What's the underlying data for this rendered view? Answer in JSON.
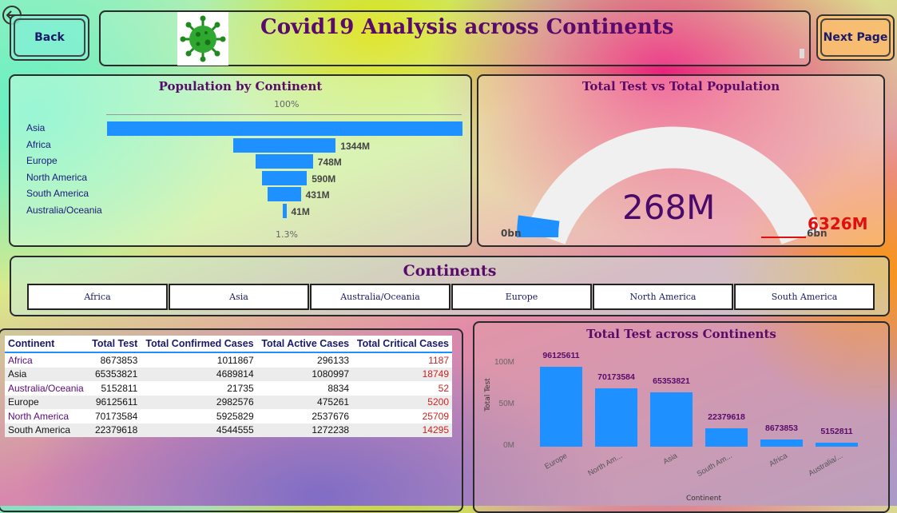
{
  "header": {
    "title": "Covid19 Analysis across Continents",
    "back_label": "Back",
    "next_label": "Next Page"
  },
  "population_chart": {
    "title": "Population by Continent",
    "top_label": "100%",
    "bottom_label": "1.3%",
    "rows": [
      {
        "label": "Asia",
        "value": 4650,
        "value_label": ""
      },
      {
        "label": "Africa",
        "value": 1344,
        "value_label": "1344M"
      },
      {
        "label": "Europe",
        "value": 748,
        "value_label": "748M"
      },
      {
        "label": "North America",
        "value": 590,
        "value_label": "590M"
      },
      {
        "label": "South America",
        "value": 431,
        "value_label": "431M"
      },
      {
        "label": "Australia/Oceania",
        "value": 41,
        "value_label": "41M"
      }
    ]
  },
  "gauge": {
    "title": "Total Test vs Total Population",
    "value_label": "268M",
    "min_label": "0bn",
    "max_label": "6bn",
    "target_label": "6326M",
    "fill_fraction": 0.045
  },
  "slicer": {
    "title": "Continents",
    "options": [
      "Africa",
      "Asia",
      "Australia/Oceania",
      "Europe",
      "North America",
      "South America"
    ]
  },
  "table": {
    "columns": [
      "Continent",
      "Total Test",
      "Total Confirmed Cases",
      "Total Active Cases",
      "Total Critical Cases"
    ],
    "rows": [
      [
        "Africa",
        "8673853",
        "1011867",
        "296133",
        "1187"
      ],
      [
        "Asia",
        "65353821",
        "4689814",
        "1080997",
        "18749"
      ],
      [
        "Australia/Oceania",
        "5152811",
        "21735",
        "8834",
        "52"
      ],
      [
        "Europe",
        "96125611",
        "2982576",
        "475261",
        "5200"
      ],
      [
        "North America",
        "70173584",
        "5925829",
        "2537676",
        "25709"
      ],
      [
        "South America",
        "22379618",
        "4544555",
        "1272238",
        "14295"
      ]
    ]
  },
  "chart_data": {
    "type": "bar",
    "title": "Total Test across Continents",
    "xlabel": "Continent",
    "ylabel": "Total Test",
    "categories": [
      "Europe",
      "North Am...",
      "Asia",
      "South Am...",
      "Africa",
      "Australia/..."
    ],
    "values": [
      96125611,
      70173584,
      65353821,
      22379618,
      8673853,
      5152811
    ],
    "value_labels": [
      "96125611",
      "70173584",
      "65353821",
      "22379618",
      "8673853",
      "5152811"
    ],
    "y_ticks": [
      "0M",
      "50M",
      "100M"
    ],
    "ylim": [
      0,
      100000000
    ],
    "color": "#1e90ff"
  }
}
